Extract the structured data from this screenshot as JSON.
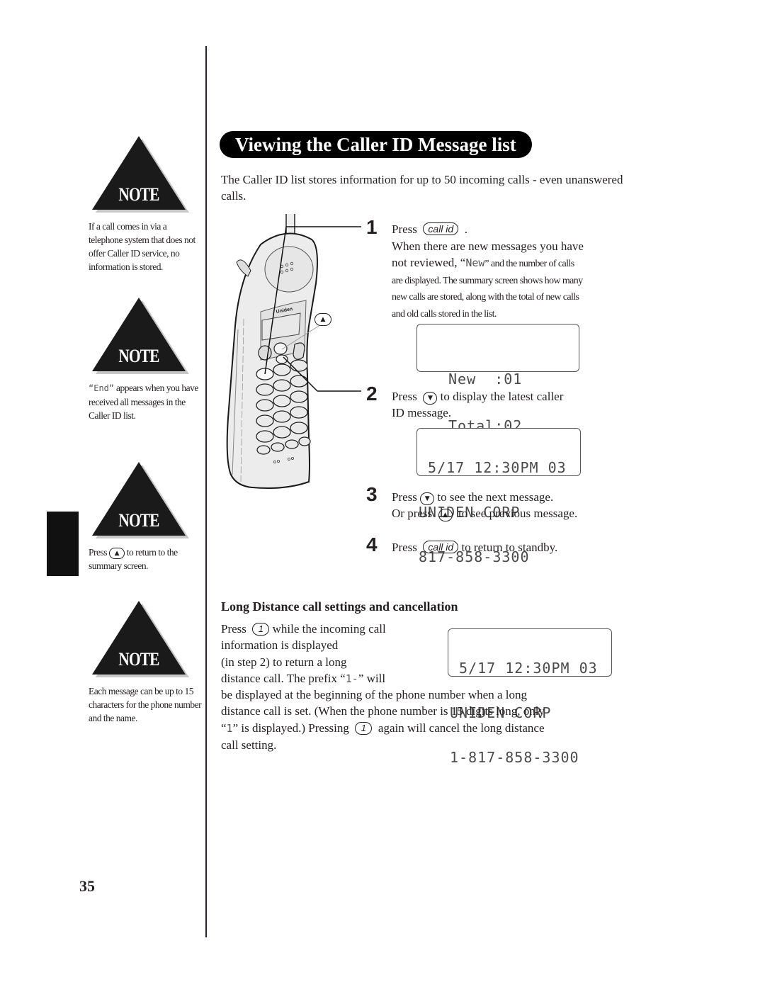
{
  "page": {
    "number": "35"
  },
  "notes": [
    {
      "label": "NOTE",
      "text": "If a call comes in via a telephone system that does not offer Caller ID service, no information is stored."
    },
    {
      "label": "NOTE",
      "lcd_word": "“End”",
      "text": " appears when you have received all messages in the Caller ID list."
    },
    {
      "label": "NOTE",
      "text_before": "Press ",
      "button_glyph": "▲",
      "text_after": " to return to the summary screen."
    },
    {
      "label": "NOTE",
      "text": "Each message can be up to 15 characters for the phone number and the name."
    }
  ],
  "section": {
    "title": "Viewing the Caller ID Message list",
    "intro": "The Caller ID list stores information for up to 50 incoming calls - even unanswered calls."
  },
  "phone": {
    "brand": "Uniden",
    "callout_button_glyph": "▲"
  },
  "steps": [
    {
      "number": "1",
      "press": "Press",
      "button": "call id",
      "after": ".",
      "line2": "When there are new messages you have",
      "line3_before": "not reviewed, “",
      "line3_lcd": "New",
      "line3_after": "” and the number of calls",
      "detail": [
        "are displayed. The summary screen shows how many",
        "new calls are stored, along with the total of new calls",
        "and old calls stored in the list."
      ],
      "display": [
        "New  :01",
        "Total:02"
      ]
    },
    {
      "number": "2",
      "press": "Press",
      "button_glyph": "▼",
      "after": "to display the latest caller",
      "line2": "ID message.",
      "display": [
        " 5/17 12:30PM 03",
        "UNIDEN CORP",
        "817-858-3300"
      ]
    },
    {
      "number": "3",
      "press": "Press",
      "button_glyph": "▼",
      "after": "to see the next message.",
      "line2_before": "Or press",
      "line2_glyph": "▲",
      "line2_after": "to see previous message."
    },
    {
      "number": "4",
      "press": "Press",
      "button": "call id",
      "after": "to return to standby."
    }
  ],
  "long_distance": {
    "heading": "Long Distance call settings and cancellation",
    "press": "Press",
    "button": "1",
    "lines_narrow": [
      "while the incoming call",
      "information is displayed",
      "(in step 2) to return a long"
    ],
    "prefix_line_before": "distance call. The prefix “",
    "prefix_lcd": "1-",
    "prefix_line_after": "” will",
    "lines_wide": [
      "be displayed at the beginning of the phone number when a long",
      "distance call is set. (When the phone number is 15 digits long, only"
    ],
    "quote_open": "“",
    "only_lcd": "1",
    "quote_rest": "” is displayed.) Pressing",
    "again_text": "again will cancel the long distance",
    "last_line": "call setting.",
    "display": [
      " 5/17 12:30PM 03",
      "UNIDEN CORP",
      "1-817-858-3300"
    ]
  }
}
